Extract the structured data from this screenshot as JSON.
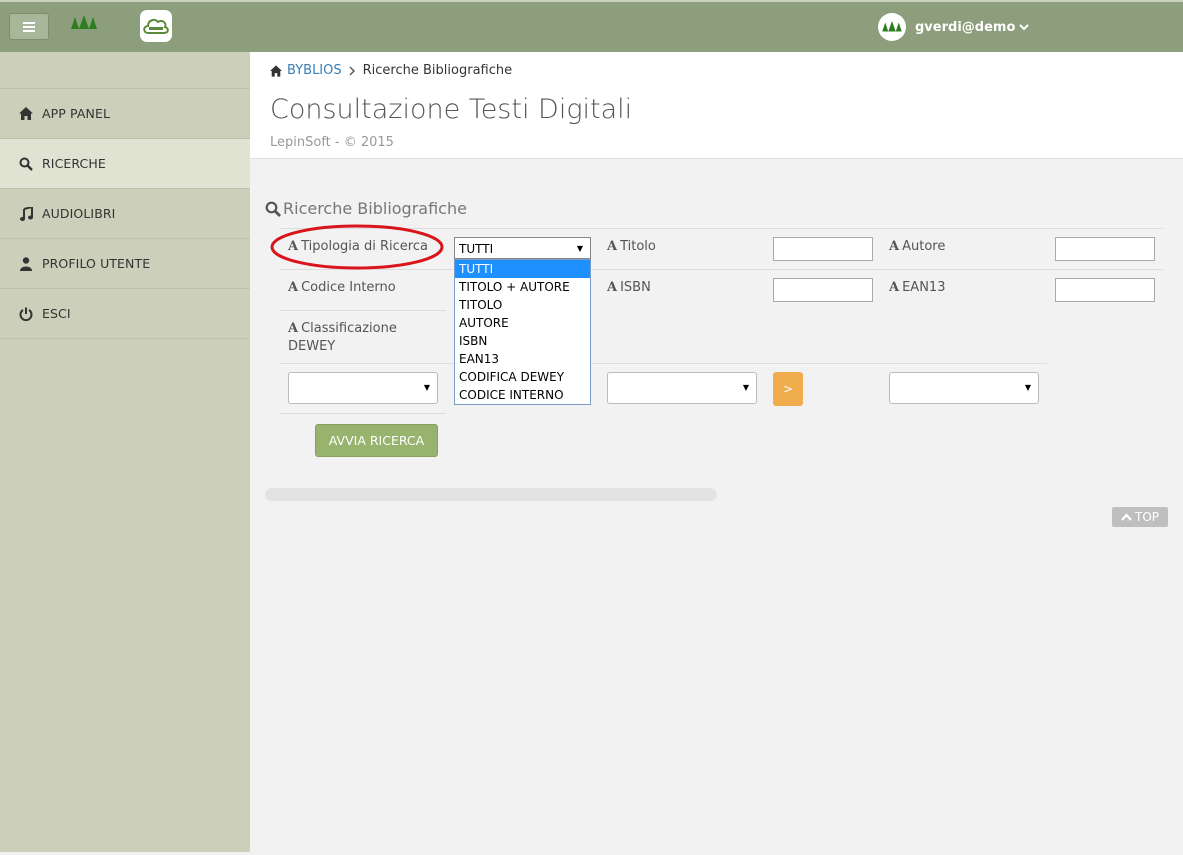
{
  "topbar": {
    "user_name": "gverdi@demo"
  },
  "sidebar": {
    "items": [
      {
        "label": "APP PANEL",
        "icon": "home-icon"
      },
      {
        "label": "RICERCHE",
        "icon": "search-icon"
      },
      {
        "label": "AUDIOLIBRI",
        "icon": "music-icon"
      },
      {
        "label": "PROFILO UTENTE",
        "icon": "user-icon"
      },
      {
        "label": "ESCI",
        "icon": "power-icon"
      }
    ]
  },
  "header": {
    "breadcrumb_root": "BYBLIOS",
    "breadcrumb_current": "Ricerche Bibliografiche",
    "title": "Consultazione Testi Digitali",
    "subtitle": "LepinSoft - © 2015"
  },
  "search": {
    "section_title": "Ricerche Bibliografiche",
    "label_a": "A",
    "fields": {
      "tipologia_label": "Tipologia di Ricerca",
      "titolo_label": "Titolo",
      "autore_label": "Autore",
      "codice_label": "Codice Interno",
      "isbn_label": "ISBN",
      "ean_label": "EAN13",
      "class_label_1": "Classificazione",
      "class_label_2": "DEWEY"
    },
    "tipologia_selected": "TUTTI",
    "tipologia_options": [
      "TUTTI",
      "TITOLO + AUTORE",
      "TITOLO",
      "AUTORE",
      "ISBN",
      "EAN13",
      "CODIFICA DEWEY",
      "CODICE INTERNO"
    ],
    "next_label": ">",
    "submit_label": "AVVIA RICERCA"
  },
  "footer": {
    "top_label": "TOP"
  },
  "colors": {
    "topbar": "#8d9e7c",
    "sidebar": "#cccfb9",
    "accent_orange": "#f0ad4e",
    "accent_green": "#98b36e",
    "annotation_red": "#d9141b"
  }
}
